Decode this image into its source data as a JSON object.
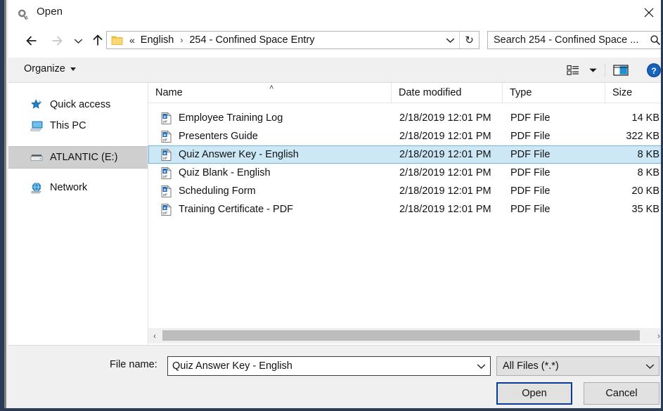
{
  "window": {
    "title": "Open",
    "title_icon": "key-icon",
    "close_label": "✕"
  },
  "nav": {
    "back_icon": "arrow-left-icon",
    "forward_icon": "arrow-right-icon",
    "recent_icon": "chevron-down-icon",
    "up_icon": "arrow-up-icon",
    "address": {
      "folder_icon": "folder-icon",
      "overflow": "«",
      "crumbs": [
        "English",
        "254 - Confined Space Entry"
      ],
      "separator": "›",
      "dropdown_icon": "chevron-down-icon",
      "refresh_icon": "↻"
    },
    "search": {
      "value": "Search 254 - Confined Space ...",
      "placeholder": "Search 254 - Confined Space ...",
      "icon": "search-icon"
    }
  },
  "toolbar": {
    "organize_label": "Organize",
    "organize_caret": "chevron-down-icon",
    "view_icon": "view-list-icon",
    "view_caret": "chevron-down-icon",
    "preview_icon": "preview-pane-icon",
    "help_icon": "help-icon",
    "help_glyph": "?"
  },
  "sidebar": {
    "items": [
      {
        "label": "Quick access",
        "icon": "star-pin-icon",
        "selected": false
      },
      {
        "label": "This PC",
        "icon": "computer-icon",
        "selected": false
      },
      {
        "label": "ATLANTIC (E:)",
        "icon": "drive-icon",
        "selected": true
      },
      {
        "label": "Network",
        "icon": "network-globe-icon",
        "selected": false
      }
    ]
  },
  "filelist": {
    "columns": [
      {
        "label": "Name",
        "sorted": true,
        "sort_caret": "˄"
      },
      {
        "label": "Date modified",
        "sorted": false
      },
      {
        "label": "Type",
        "sorted": false
      },
      {
        "label": "Size",
        "sorted": false
      }
    ],
    "rows": [
      {
        "name": "Employee Training Log",
        "date": "2/18/2019 12:01 PM",
        "type": "PDF File",
        "size": "14 KB",
        "icon": "pdf-file-icon",
        "selected": false
      },
      {
        "name": "Presenters Guide",
        "date": "2/18/2019 12:01 PM",
        "type": "PDF File",
        "size": "322 KB",
        "icon": "pdf-file-icon",
        "selected": false
      },
      {
        "name": "Quiz Answer Key - English",
        "date": "2/18/2019 12:01 PM",
        "type": "PDF File",
        "size": "8 KB",
        "icon": "pdf-file-icon",
        "selected": true
      },
      {
        "name": "Quiz Blank - English",
        "date": "2/18/2019 12:01 PM",
        "type": "PDF File",
        "size": "8 KB",
        "icon": "pdf-file-icon",
        "selected": false
      },
      {
        "name": "Scheduling Form",
        "date": "2/18/2019 12:01 PM",
        "type": "PDF File",
        "size": "20 KB",
        "icon": "pdf-file-icon",
        "selected": false
      },
      {
        "name": "Training Certificate - PDF",
        "date": "2/18/2019 12:01 PM",
        "type": "PDF File",
        "size": "35 KB",
        "icon": "pdf-file-icon",
        "selected": false
      }
    ]
  },
  "scrollbar": {
    "left_arrow": "‹",
    "right_arrow": "›"
  },
  "footer": {
    "filename_label": "File name:",
    "filename_value": "Quiz Answer Key - English",
    "filename_caret": "chevron-down-icon",
    "filetype_value": "All Files (*.*)",
    "filetype_caret": "chevron-down-icon",
    "open_label": "Open",
    "cancel_label": "Cancel"
  },
  "colors": {
    "selection_fill": "#cce8f7",
    "selection_border": "#6fb6dd",
    "sidebar_selection": "#cfcfcf",
    "accent_blue": "#0b3c91",
    "chrome_gray": "#f0f0f0",
    "frame_navy": "#2b3a55"
  }
}
